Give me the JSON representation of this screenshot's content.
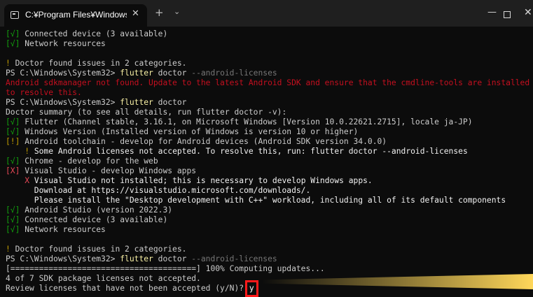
{
  "window": {
    "tab_title": "C:¥Program Files¥WindowsAp",
    "tab_close": "✕",
    "new_tab": "+",
    "dropdown": "⌄",
    "minimize": "—",
    "close": "✕"
  },
  "colors": {
    "background": "#0c0c0c",
    "ok": "#13a10e",
    "warning": "#c19c00",
    "error": "#e74856",
    "command": "#f9f1a5",
    "highlight_box": "#ff1a1a",
    "callout": "#ffd75a"
  },
  "terminal": {
    "lines": [
      {
        "segments": [
          {
            "cls": "g",
            "text": "[√]"
          },
          {
            "cls": "",
            "text": " Connected device (3 available)"
          }
        ]
      },
      {
        "segments": [
          {
            "cls": "g",
            "text": "[√]"
          },
          {
            "cls": "",
            "text": " Network resources"
          }
        ]
      },
      {
        "segments": [
          {
            "cls": "",
            "text": ""
          }
        ]
      },
      {
        "segments": [
          {
            "cls": "y",
            "text": "!"
          },
          {
            "cls": "",
            "text": " Doctor found issues in 2 categories."
          }
        ]
      },
      {
        "segments": [
          {
            "cls": "",
            "text": "PS C:\\Windows\\System32> "
          },
          {
            "cls": "cmd",
            "text": "flutter"
          },
          {
            "cls": "",
            "text": " doctor "
          },
          {
            "cls": "gr",
            "text": "--android-licenses"
          }
        ]
      },
      {
        "segments": [
          {
            "cls": "rd",
            "text": "Android sdkmanager not found. Update to the latest Android SDK and ensure that the cmdline-tools are installed"
          }
        ]
      },
      {
        "segments": [
          {
            "cls": "rd",
            "text": "to resolve this."
          }
        ]
      },
      {
        "segments": [
          {
            "cls": "",
            "text": "PS C:\\Windows\\System32> "
          },
          {
            "cls": "cmd",
            "text": "flutter"
          },
          {
            "cls": "",
            "text": " doctor"
          }
        ]
      },
      {
        "segments": [
          {
            "cls": "",
            "text": "Doctor summary (to see all details, run flutter doctor -v):"
          }
        ]
      },
      {
        "segments": [
          {
            "cls": "g",
            "text": "[√]"
          },
          {
            "cls": "",
            "text": " Flutter (Channel stable, 3.16.1, on Microsoft Windows [Version 10.0.22621.2715], locale ja-JP)"
          }
        ]
      },
      {
        "segments": [
          {
            "cls": "g",
            "text": "[√]"
          },
          {
            "cls": "",
            "text": " Windows Version (Installed version of Windows is version 10 or higher)"
          }
        ]
      },
      {
        "segments": [
          {
            "cls": "y",
            "text": "[!]"
          },
          {
            "cls": "",
            "text": " Android toolchain - develop for Android devices (Android SDK version 34.0.0)"
          }
        ]
      },
      {
        "segments": [
          {
            "cls": "",
            "text": "    "
          },
          {
            "cls": "y",
            "text": "!"
          },
          {
            "cls": "w",
            "text": " Some Android licenses not accepted. To resolve this, run: flutter doctor --android-licenses"
          }
        ]
      },
      {
        "segments": [
          {
            "cls": "g",
            "text": "[√]"
          },
          {
            "cls": "",
            "text": " Chrome - develop for the web"
          }
        ]
      },
      {
        "segments": [
          {
            "cls": "r",
            "text": "[X]"
          },
          {
            "cls": "",
            "text": " Visual Studio - develop Windows apps"
          }
        ]
      },
      {
        "segments": [
          {
            "cls": "",
            "text": "    "
          },
          {
            "cls": "r",
            "text": "X"
          },
          {
            "cls": "w",
            "text": " Visual Studio not installed; this is necessary to develop Windows apps."
          }
        ]
      },
      {
        "segments": [
          {
            "cls": "w",
            "text": "      Download at https://visualstudio.microsoft.com/downloads/."
          }
        ]
      },
      {
        "segments": [
          {
            "cls": "w",
            "text": "      Please install the \"Desktop development with C++\" workload, including all of its default components"
          }
        ]
      },
      {
        "segments": [
          {
            "cls": "g",
            "text": "[√]"
          },
          {
            "cls": "",
            "text": " Android Studio (version 2022.3)"
          }
        ]
      },
      {
        "segments": [
          {
            "cls": "g",
            "text": "[√]"
          },
          {
            "cls": "",
            "text": " Connected device (3 available)"
          }
        ]
      },
      {
        "segments": [
          {
            "cls": "g",
            "text": "[√]"
          },
          {
            "cls": "",
            "text": " Network resources"
          }
        ]
      },
      {
        "segments": [
          {
            "cls": "",
            "text": ""
          }
        ]
      },
      {
        "segments": [
          {
            "cls": "y",
            "text": "!"
          },
          {
            "cls": "",
            "text": " Doctor found issues in 2 categories."
          }
        ]
      },
      {
        "segments": [
          {
            "cls": "",
            "text": "PS C:\\Windows\\System32> "
          },
          {
            "cls": "cmd",
            "text": "flutter"
          },
          {
            "cls": "",
            "text": " doctor "
          },
          {
            "cls": "gr",
            "text": "--android-licenses"
          }
        ]
      },
      {
        "segments": [
          {
            "cls": "",
            "text": "[=======================================] 100% Computing updates..."
          }
        ]
      },
      {
        "segments": [
          {
            "cls": "",
            "text": "4 of 7 SDK package licenses not accepted."
          }
        ]
      }
    ],
    "prompt_text": "Review licenses that have not been accepted (y/N)? ",
    "answer": "y"
  }
}
